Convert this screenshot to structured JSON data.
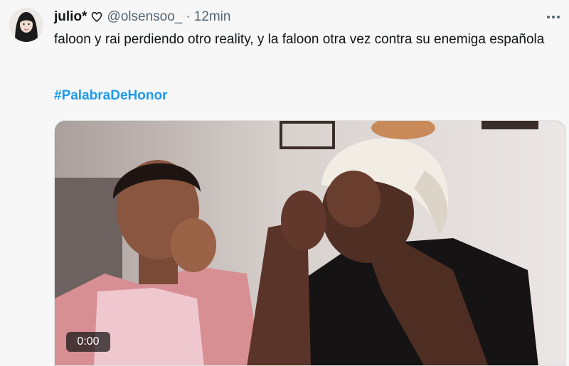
{
  "tweet": {
    "author": {
      "display_name": "julio*",
      "handle": "@olsensoo_",
      "avatar_icon": "avatar-photo",
      "name_emoji_icon": "heart-outline-emoji-icon"
    },
    "separator": "·",
    "time": "12min",
    "more_icon": "more-horizontal-icon",
    "text": "faloon y rai perdiendo otro reality, y la faloon otra vez contra su enemiga española",
    "hashtag": "#PalabraDeHonor",
    "media": {
      "type": "video",
      "duration": "0:00"
    }
  },
  "colors": {
    "background": "#f7f7f7",
    "text": "#0f1419",
    "secondary_text": "#536471",
    "hashtag": "#1d9bf0"
  }
}
